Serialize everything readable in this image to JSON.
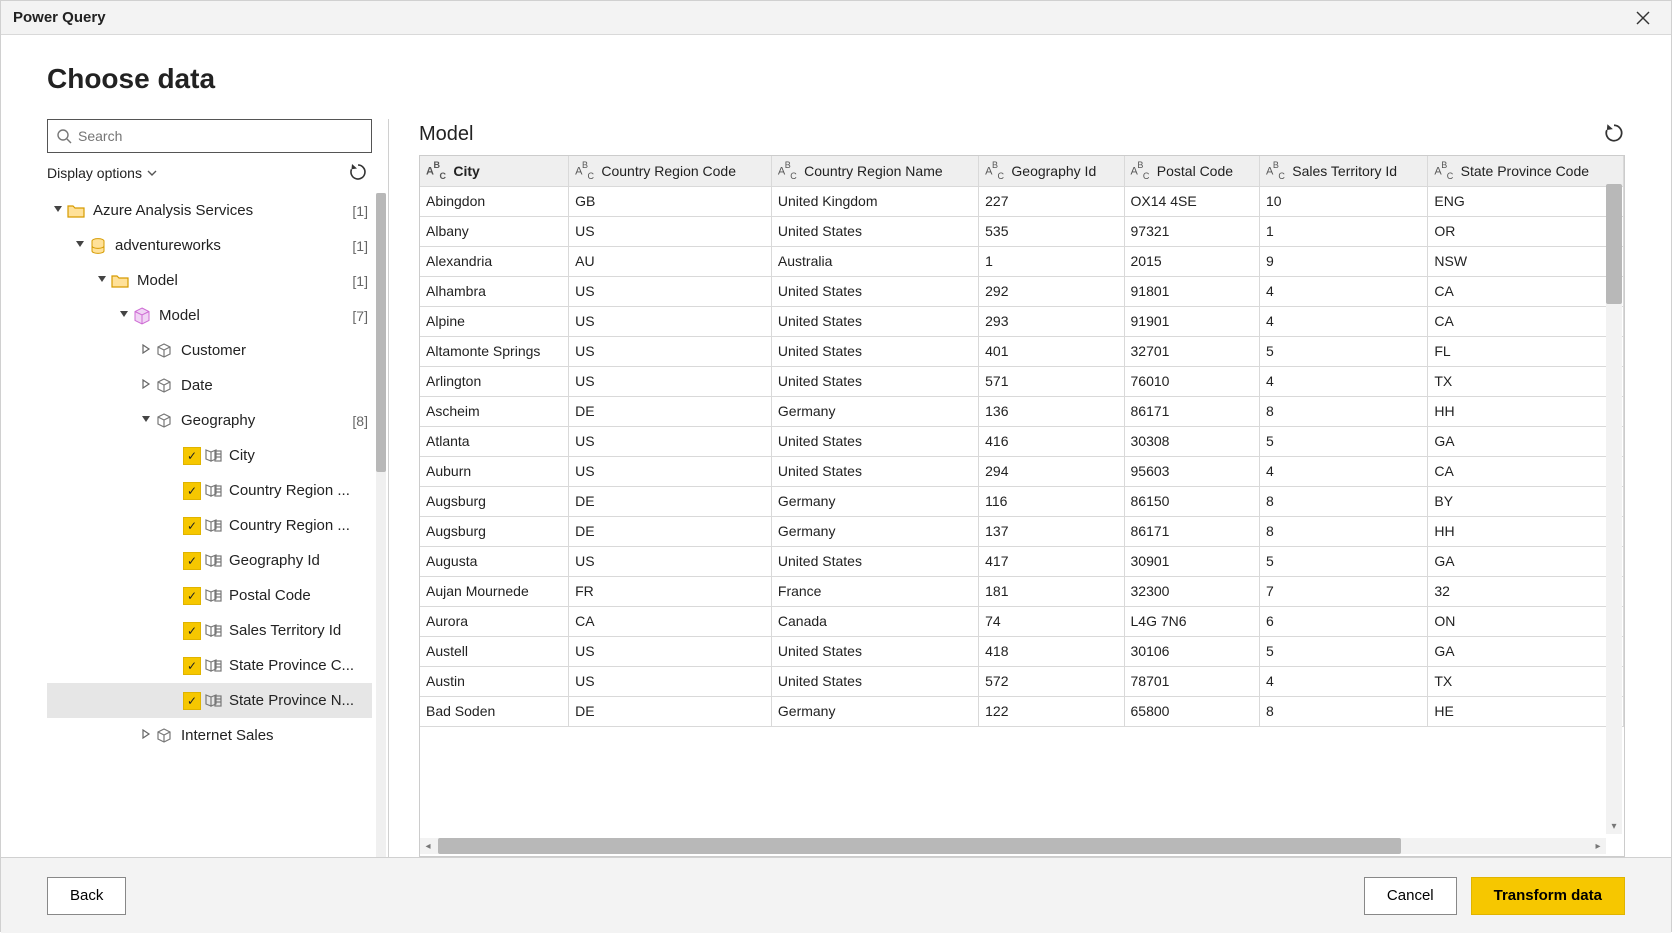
{
  "window": {
    "title": "Power Query"
  },
  "heading": "Choose data",
  "search": {
    "placeholder": "Search"
  },
  "display_options_label": "Display options",
  "tree": [
    {
      "level": 0,
      "expander": "down",
      "icon": "folder",
      "label": "Azure Analysis Services",
      "count": "[1]"
    },
    {
      "level": 1,
      "expander": "down",
      "icon": "database",
      "label": "adventureworks",
      "count": "[1]"
    },
    {
      "level": 2,
      "expander": "down",
      "icon": "folder",
      "label": "Model",
      "count": "[1]"
    },
    {
      "level": 3,
      "expander": "down",
      "icon": "cube",
      "label": "Model",
      "count": "[7]"
    },
    {
      "level": 4,
      "expander": "right",
      "icon": "dimension",
      "label": "Customer"
    },
    {
      "level": 4,
      "expander": "right",
      "icon": "dimension",
      "label": "Date"
    },
    {
      "level": 4,
      "expander": "down",
      "icon": "dimension",
      "label": "Geography",
      "count": "[8]"
    },
    {
      "level": 5,
      "checkbox": true,
      "checked": true,
      "icon": "column",
      "label": "City"
    },
    {
      "level": 5,
      "checkbox": true,
      "checked": true,
      "icon": "column",
      "label": "Country Region ..."
    },
    {
      "level": 5,
      "checkbox": true,
      "checked": true,
      "icon": "column",
      "label": "Country Region ..."
    },
    {
      "level": 5,
      "checkbox": true,
      "checked": true,
      "icon": "column",
      "label": "Geography Id"
    },
    {
      "level": 5,
      "checkbox": true,
      "checked": true,
      "icon": "column",
      "label": "Postal Code"
    },
    {
      "level": 5,
      "checkbox": true,
      "checked": true,
      "icon": "column",
      "label": "Sales Territory Id"
    },
    {
      "level": 5,
      "checkbox": true,
      "checked": true,
      "icon": "column",
      "label": "State Province C..."
    },
    {
      "level": 5,
      "checkbox": true,
      "checked": true,
      "icon": "column",
      "label": "State Province N...",
      "selected": true
    },
    {
      "level": 4,
      "expander": "right",
      "icon": "dimension",
      "label": "Internet Sales"
    }
  ],
  "preview": {
    "title": "Model",
    "columns": [
      "City",
      "Country Region Code",
      "Country Region Name",
      "Geography Id",
      "Postal Code",
      "Sales Territory Id",
      "State Province Code"
    ],
    "rows": [
      [
        "Abingdon",
        "GB",
        "United Kingdom",
        "227",
        "OX14 4SE",
        "10",
        "ENG"
      ],
      [
        "Albany",
        "US",
        "United States",
        "535",
        "97321",
        "1",
        "OR"
      ],
      [
        "Alexandria",
        "AU",
        "Australia",
        "1",
        "2015",
        "9",
        "NSW"
      ],
      [
        "Alhambra",
        "US",
        "United States",
        "292",
        "91801",
        "4",
        "CA"
      ],
      [
        "Alpine",
        "US",
        "United States",
        "293",
        "91901",
        "4",
        "CA"
      ],
      [
        "Altamonte Springs",
        "US",
        "United States",
        "401",
        "32701",
        "5",
        "FL"
      ],
      [
        "Arlington",
        "US",
        "United States",
        "571",
        "76010",
        "4",
        "TX"
      ],
      [
        "Ascheim",
        "DE",
        "Germany",
        "136",
        "86171",
        "8",
        "HH"
      ],
      [
        "Atlanta",
        "US",
        "United States",
        "416",
        "30308",
        "5",
        "GA"
      ],
      [
        "Auburn",
        "US",
        "United States",
        "294",
        "95603",
        "4",
        "CA"
      ],
      [
        "Augsburg",
        "DE",
        "Germany",
        "116",
        "86150",
        "8",
        "BY"
      ],
      [
        "Augsburg",
        "DE",
        "Germany",
        "137",
        "86171",
        "8",
        "HH"
      ],
      [
        "Augusta",
        "US",
        "United States",
        "417",
        "30901",
        "5",
        "GA"
      ],
      [
        "Aujan Mournede",
        "FR",
        "France",
        "181",
        "32300",
        "7",
        "32"
      ],
      [
        "Aurora",
        "CA",
        "Canada",
        "74",
        "L4G 7N6",
        "6",
        "ON"
      ],
      [
        "Austell",
        "US",
        "United States",
        "418",
        "30106",
        "5",
        "GA"
      ],
      [
        "Austin",
        "US",
        "United States",
        "572",
        "78701",
        "4",
        "TX"
      ],
      [
        "Bad Soden",
        "DE",
        "Germany",
        "122",
        "65800",
        "8",
        "HE"
      ]
    ]
  },
  "footer": {
    "back": "Back",
    "cancel": "Cancel",
    "transform": "Transform data"
  }
}
